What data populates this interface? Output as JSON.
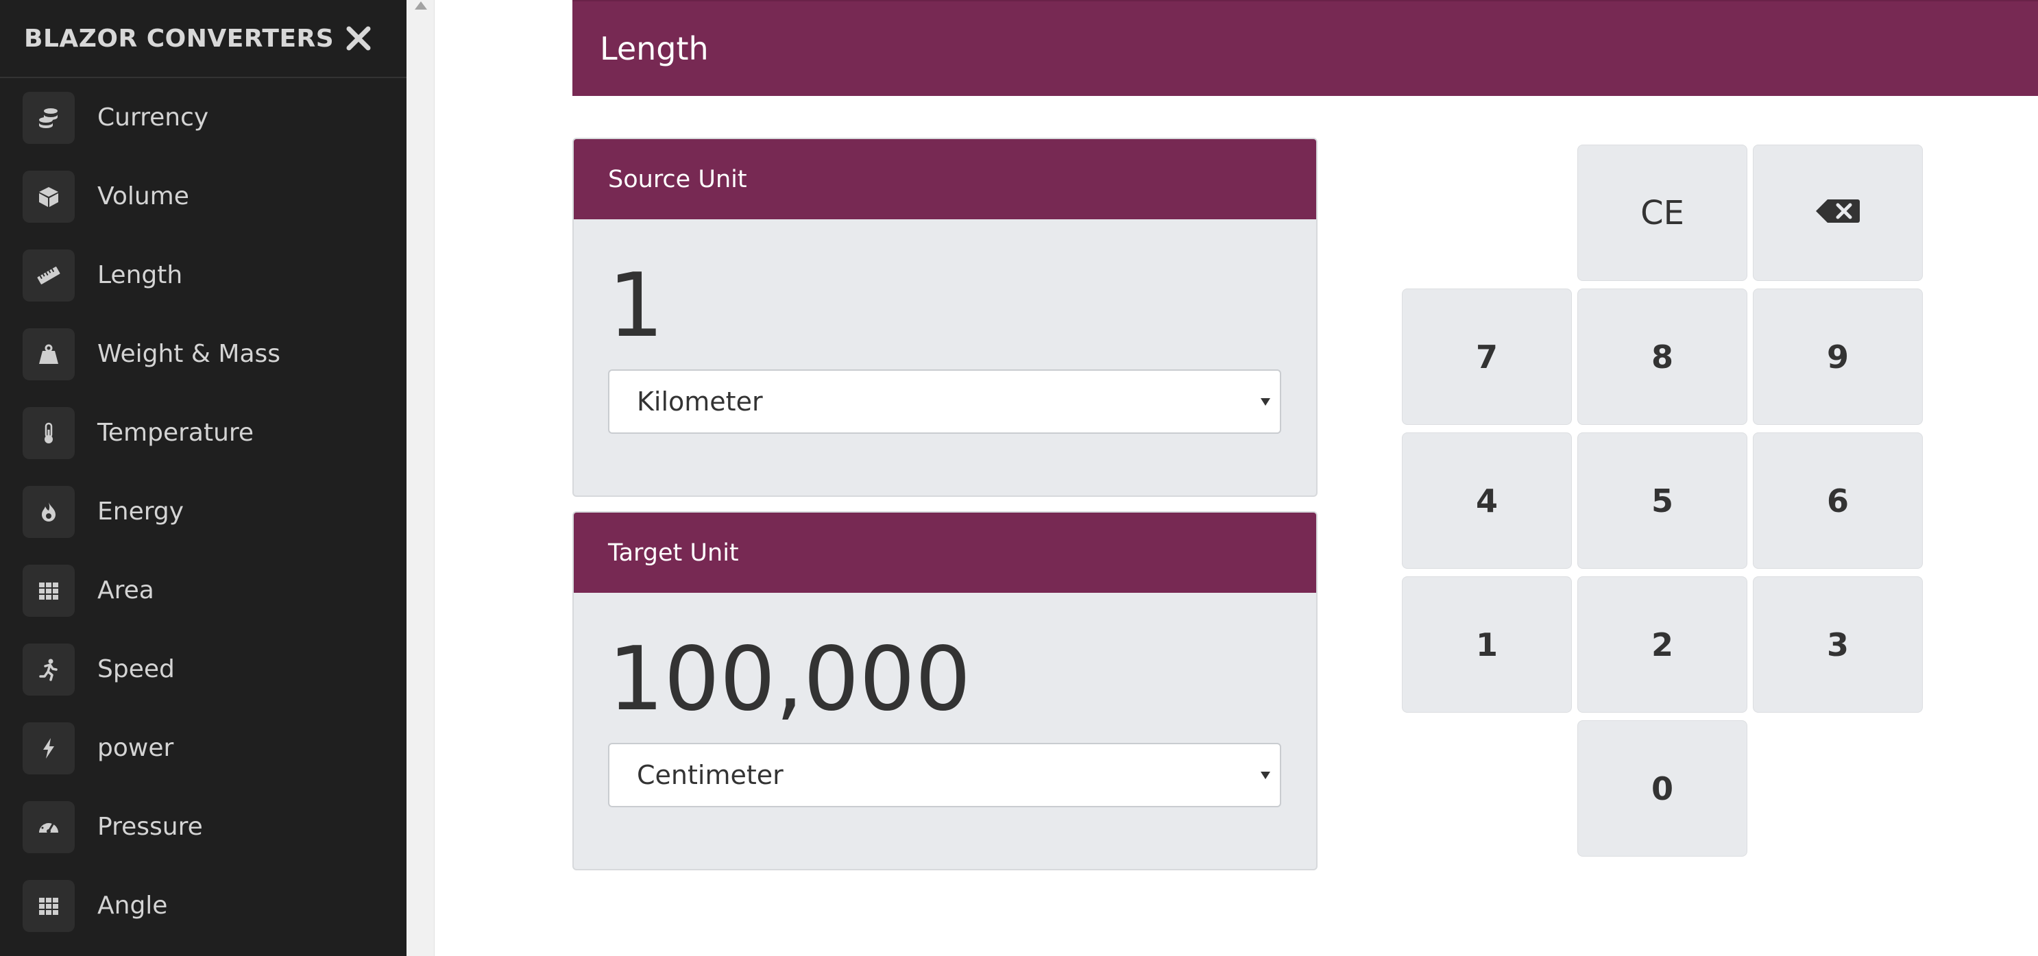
{
  "sidebar": {
    "brand": "BLAZOR CONVERTERS",
    "close_icon": "close-icon",
    "items": [
      {
        "label": "Currency",
        "icon": "coins-icon"
      },
      {
        "label": "Volume",
        "icon": "cube-icon"
      },
      {
        "label": "Length",
        "icon": "ruler-icon"
      },
      {
        "label": "Weight & Mass",
        "icon": "weight-icon"
      },
      {
        "label": "Temperature",
        "icon": "thermometer-icon"
      },
      {
        "label": "Energy",
        "icon": "fire-icon"
      },
      {
        "label": "Area",
        "icon": "grid-icon"
      },
      {
        "label": "Speed",
        "icon": "running-icon"
      },
      {
        "label": "power",
        "icon": "bolt-icon"
      },
      {
        "label": "Pressure",
        "icon": "gauge-icon"
      },
      {
        "label": "Angle",
        "icon": "grid-icon"
      }
    ]
  },
  "header": {
    "title": "Length"
  },
  "source": {
    "title": "Source Unit",
    "value": "1",
    "unit": "Kilometer"
  },
  "target": {
    "title": "Target Unit",
    "value": "100,000",
    "unit": "Centimeter"
  },
  "keypad": {
    "clear_label": "CE",
    "backspace_icon": "backspace-icon",
    "digits": [
      "7",
      "8",
      "9",
      "4",
      "5",
      "6",
      "1",
      "2",
      "3",
      "0"
    ]
  },
  "colors": {
    "accent": "#772953",
    "sidebar_bg": "#1f1f1f",
    "panel_bg": "#e8eaed"
  }
}
